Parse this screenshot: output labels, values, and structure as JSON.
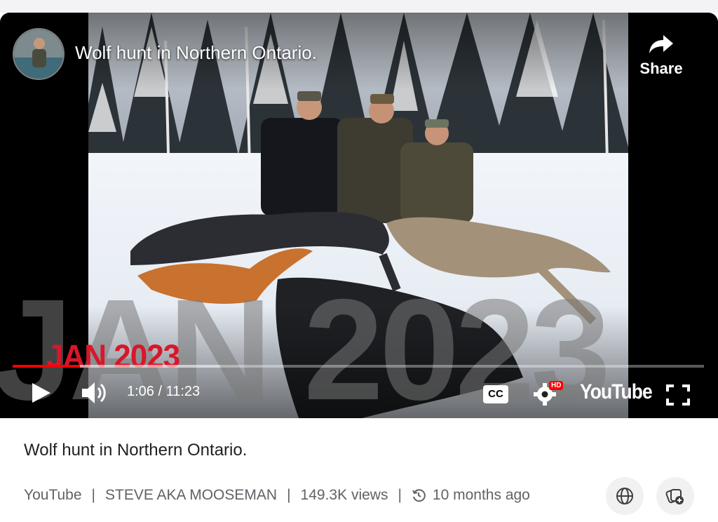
{
  "player": {
    "title": "Wolf hunt in Northern Ontario.",
    "share_label": "Share",
    "date_overlay": "JAN 2023",
    "watermark_text": "JAN 2023",
    "time": "1:06 / 11:23",
    "progress": 0.097,
    "buffered": 0.3,
    "brand": "YouTube",
    "hd_badge": "HD",
    "cc_label": "CC",
    "colors": {
      "progress": "#ff0000",
      "date_overlay": "#d8172a"
    }
  },
  "info": {
    "title": "Wolf hunt in Northern Ontario.",
    "source": "YouTube",
    "channel": "STEVE AKA MOOSEMAN",
    "views": "149.3K views",
    "age": "10 months ago",
    "separator": "|"
  },
  "icons": [
    "share-icon",
    "play-icon",
    "volume-icon",
    "cc-icon",
    "settings-icon",
    "fullscreen-icon",
    "history-icon",
    "globe-icon",
    "add-to-collection-icon"
  ]
}
